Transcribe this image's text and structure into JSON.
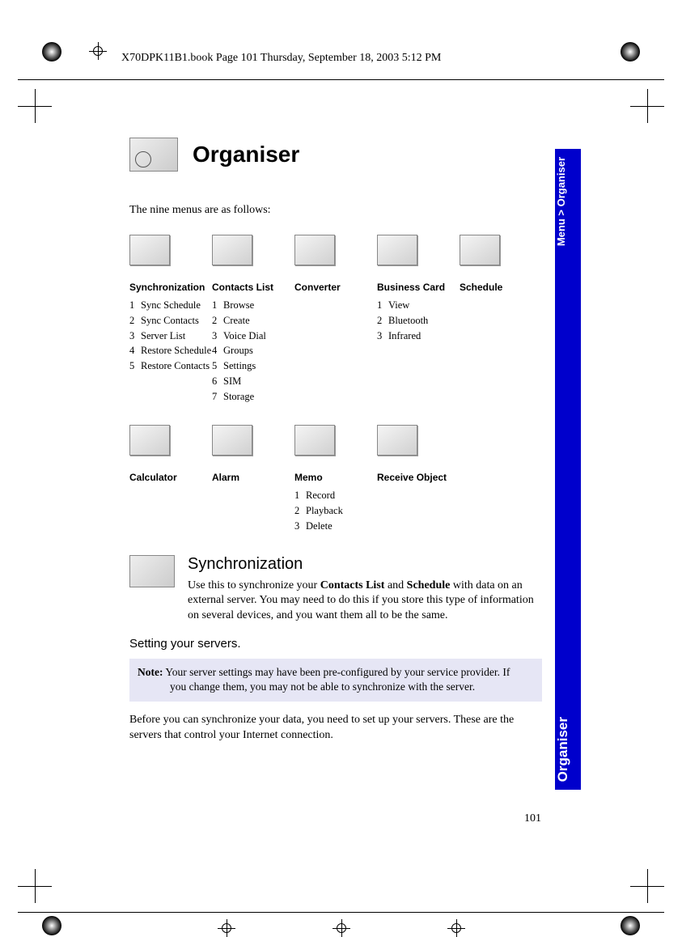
{
  "header_text": "X70DPK11B1.book  Page 101  Thursday, September 18, 2003  5:12 PM",
  "page_title": "Organiser",
  "tab_top": "Menu > Organiser",
  "tab_bottom": "Organiser",
  "intro": "The nine menus are as follows:",
  "row1": {
    "c1": {
      "title": "Synchronization",
      "items": [
        "Sync Schedule",
        "Sync Contacts",
        "Server List",
        "Restore Schedule",
        "Restore Contacts"
      ]
    },
    "c2": {
      "title": "Contacts List",
      "items": [
        "Browse",
        "Create",
        "Voice Dial",
        "Groups",
        "Settings",
        "SIM",
        "Storage"
      ]
    },
    "c3": {
      "title": "Converter",
      "items": []
    },
    "c4": {
      "title": "Business Card",
      "items": [
        "View",
        "Bluetooth",
        "Infrared"
      ]
    },
    "c5": {
      "title": "Schedule",
      "items": []
    }
  },
  "row2": {
    "c1": {
      "title": "Calculator",
      "items": []
    },
    "c2": {
      "title": "Alarm",
      "items": []
    },
    "c3": {
      "title": "Memo",
      "items": [
        "Record",
        "Playback",
        "Delete"
      ]
    },
    "c4": {
      "title": "Receive Object",
      "items": []
    }
  },
  "sync": {
    "heading": "Synchronization",
    "body_pre": "Use this to synchronize your ",
    "bold1": "Contacts List",
    "body_mid1": " and ",
    "bold2": "Schedule",
    "body_post": " with data on an external server. You may need to do this if you store this type of information on several devices, and you want them all to be the same."
  },
  "setting_heading": "Setting your servers.",
  "note": {
    "label": "Note:",
    "line1": " Your server settings may have been pre-configured by your service provider. If",
    "line2": "you change them, you may not be able to synchronize with the server."
  },
  "final_para": "Before you can synchronize your data, you need to set up your servers. These are the servers that control your Internet connection.",
  "page_number": "101"
}
